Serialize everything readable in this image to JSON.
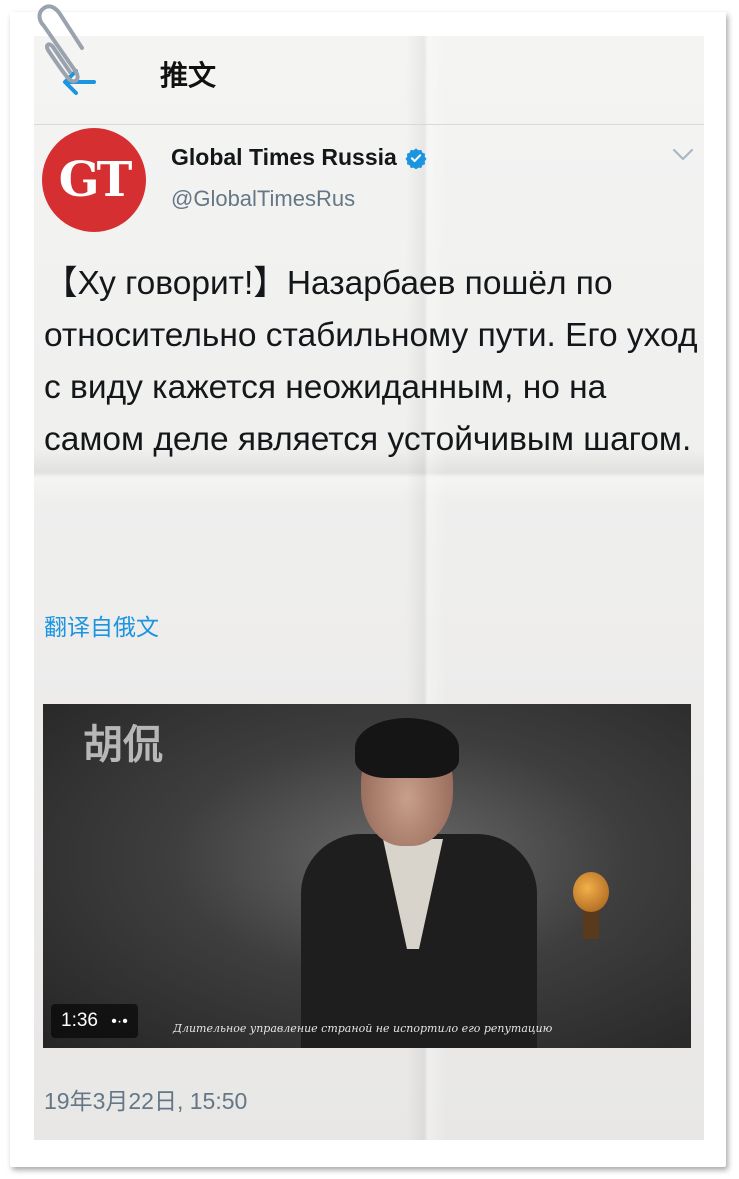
{
  "header": {
    "title": "推文"
  },
  "tweet": {
    "avatar_text": "GT",
    "display_name": "Global Times Russia",
    "handle": "@GlobalTimesRus",
    "text": "【Ху говорит!】Назарбаев пошёл по относительно стабильному пути. Его уход с виду кажется неожиданным, но на самом деле является устойчивым шагом.",
    "translate_link": "翻译自俄文",
    "timestamp": "19年3月22日, 15:50"
  },
  "video": {
    "overlay_title": "胡侃",
    "duration": "1:36",
    "subtitle": "Длительное управление страной не испортило его репутацию"
  },
  "icons": {
    "back": "arrow-left-icon",
    "verified": "verified-badge-icon",
    "menu": "chevron-down-icon",
    "attachment": "paperclip-icon"
  },
  "colors": {
    "accent": "#1b95e0",
    "avatar_bg": "#d62f31",
    "text_primary": "#14171a",
    "text_secondary": "#657786"
  }
}
